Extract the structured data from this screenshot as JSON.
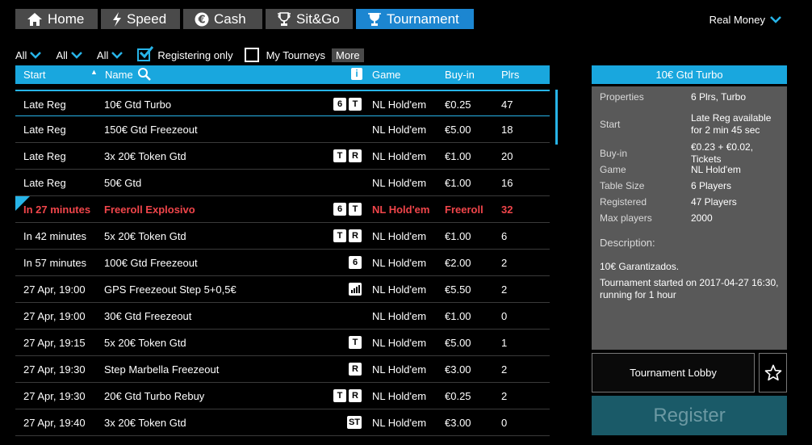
{
  "tabs": [
    {
      "label": "Home",
      "icon": "home-icon"
    },
    {
      "label": "Speed",
      "icon": "lightning-icon"
    },
    {
      "label": "Cash",
      "icon": "euro-icon"
    },
    {
      "label": "Sit&Go",
      "icon": "trophy-icon"
    },
    {
      "label": "Tournament",
      "icon": "cup-icon",
      "active": true
    }
  ],
  "currency_mode": "Real Money",
  "filters": {
    "dropdowns": [
      "All",
      "All",
      "All"
    ],
    "registering_only": {
      "label": "Registering only",
      "checked": true
    },
    "my_tourneys": {
      "label": "My Tourneys",
      "checked": false
    },
    "more": "More"
  },
  "table": {
    "headers": {
      "start": "Start",
      "name": "Name",
      "info": "i",
      "game": "Game",
      "buyin": "Buy-in",
      "plrs": "Plrs"
    },
    "rows": [
      {
        "start": "Late Reg",
        "name": "10€ Gtd Turbo",
        "badges": [
          "6",
          "T"
        ],
        "game": "NL Hold'em",
        "buyin": "€0.25",
        "plrs": "47"
      },
      {
        "start": "Late Reg",
        "name": "150€ Gtd Freezeout",
        "badges": [],
        "game": "NL Hold'em",
        "buyin": "€5.00",
        "plrs": "18"
      },
      {
        "start": "Late Reg",
        "name": "3x 20€ Token Gtd",
        "badges": [
          "T",
          "R"
        ],
        "game": "NL Hold'em",
        "buyin": "€1.00",
        "plrs": "20"
      },
      {
        "start": "Late Reg",
        "name": "50€ Gtd",
        "badges": [],
        "game": "NL Hold'em",
        "buyin": "€1.00",
        "plrs": "16"
      },
      {
        "start": "In 27 minutes",
        "name": "Freeroll Explosivo",
        "badges": [
          "6",
          "T"
        ],
        "game": "NL Hold'em",
        "buyin": "Freeroll",
        "plrs": "32",
        "highlight": true
      },
      {
        "start": "In 42 minutes",
        "name": "5x 20€ Token Gtd",
        "badges": [
          "T",
          "R"
        ],
        "game": "NL Hold'em",
        "buyin": "€1.00",
        "plrs": "6"
      },
      {
        "start": "In 57 minutes",
        "name": "100€ Gtd Freezeout",
        "badges": [
          "6"
        ],
        "game": "NL Hold'em",
        "buyin": "€2.00",
        "plrs": "2"
      },
      {
        "start": "27 Apr, 19:00",
        "name": "GPS Freezeout Step 5+0,5€",
        "badges": [
          "bars"
        ],
        "game": "NL Hold'em",
        "buyin": "€5.50",
        "plrs": "2"
      },
      {
        "start": "27 Apr, 19:00",
        "name": "30€ Gtd Freezeout",
        "badges": [],
        "game": "NL Hold'em",
        "buyin": "€1.00",
        "plrs": "0"
      },
      {
        "start": "27 Apr, 19:15",
        "name": "5x 20€ Token Gtd",
        "badges": [
          "T"
        ],
        "game": "NL Hold'em",
        "buyin": "€5.00",
        "plrs": "1"
      },
      {
        "start": "27 Apr, 19:30",
        "name": "Step Marbella Freezeout",
        "badges": [
          "R"
        ],
        "game": "NL Hold'em",
        "buyin": "€3.00",
        "plrs": "2"
      },
      {
        "start": "27 Apr, 19:30",
        "name": "20€ Gtd Turbo Rebuy",
        "badges": [
          "T",
          "R"
        ],
        "game": "NL Hold'em",
        "buyin": "€0.25",
        "plrs": "2"
      },
      {
        "start": "27 Apr, 19:40",
        "name": "3x 20€ Token Gtd",
        "badges": [
          "ST"
        ],
        "game": "NL Hold'em",
        "buyin": "€3.00",
        "plrs": "0"
      }
    ]
  },
  "details": {
    "title": "10€ Gtd Turbo",
    "properties": [
      {
        "label": "Properties",
        "value": "6 Plrs, Turbo"
      },
      {
        "label": "Start",
        "value": "Late Reg available for 2 min 45 sec"
      },
      {
        "label": "Buy-in",
        "value": "€0.23 + €0.02, Tickets"
      },
      {
        "label": "Game",
        "value": "NL Hold'em"
      },
      {
        "label": "Table Size",
        "value": "6 Players"
      },
      {
        "label": "Registered",
        "value": "47 Players"
      },
      {
        "label": "Max players",
        "value": "2000"
      }
    ],
    "description_heading": "Description:",
    "description_line1": "10€ Garantizados.",
    "description_line2": "Tournament started on 2017-04-27 16:30, running for 1 hour"
  },
  "buttons": {
    "lobby": "Tournament Lobby",
    "register": "Register"
  },
  "colors": {
    "accent": "#19a7de",
    "active_tab": "#1c86d1",
    "highlight": "#f0454a",
    "panel": "#595959"
  }
}
